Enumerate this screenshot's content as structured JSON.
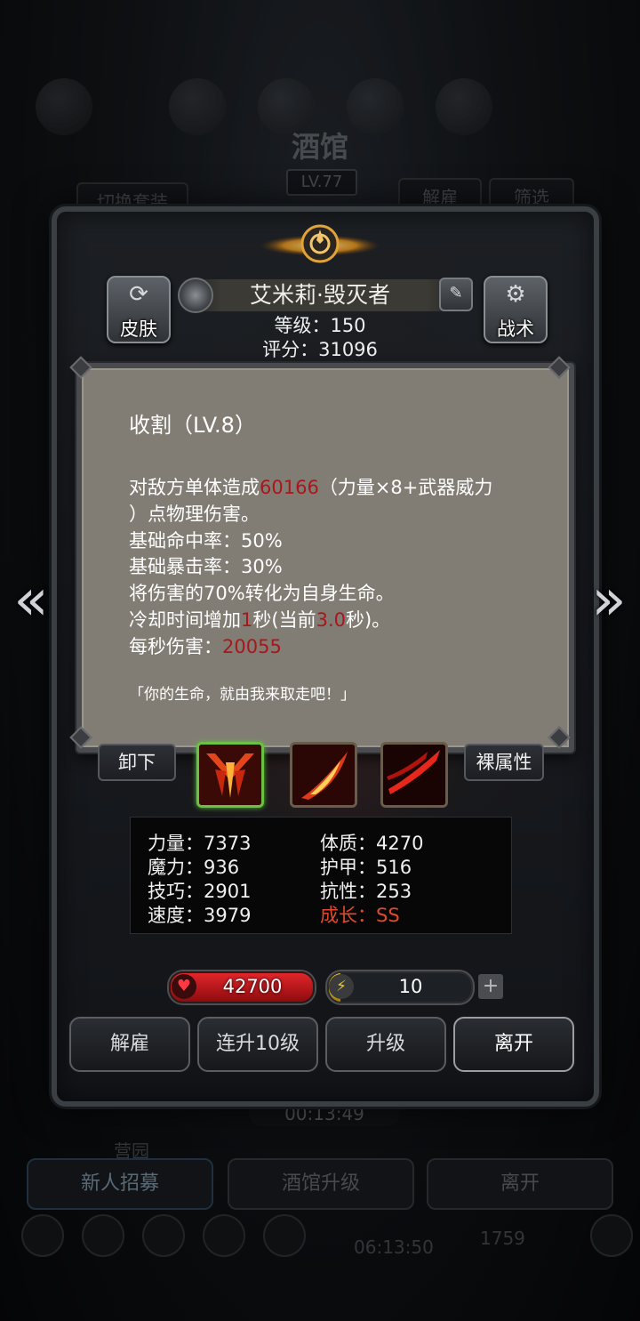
{
  "background": {
    "title": "酒馆",
    "level": "LV.77",
    "switch_outfit": "切换套装",
    "dismiss": "解雇",
    "filter": "筛选",
    "timer": "00:13:49",
    "tabs": [
      "新人招募",
      "酒馆升级",
      "离开"
    ],
    "label_small": "营园",
    "bottom_timer": "06:13:50",
    "bottom_count": "1759"
  },
  "hero": {
    "name": "艾米莉·毁灭者",
    "level_text": "等级：150",
    "score_text": "评分：31096",
    "skin_label": "皮肤",
    "tactics_label": "战术"
  },
  "tooltip": {
    "title": "收割（LV.8）",
    "line1_pre": "对敌方单体造成",
    "line1_val": "60166",
    "line1_post": "（力量×8+武器威力",
    "line2": "）点物理伤害。",
    "line3": "基础命中率：50%",
    "line4": "基础暴击率：30%",
    "line5": "将伤害的70%转化为自身生命。",
    "line6_pre": "冷却时间增加",
    "line6_val1": "1",
    "line6_mid": "秒(当前",
    "line6_val2": "3.0",
    "line6_post": "秒)。",
    "line7_pre": "每秒伤害：",
    "line7_val": "20055",
    "quote": "「你的生命，就由我来取走吧！」"
  },
  "skills": {
    "unequip": "卸下",
    "naked_attr": "裸属性"
  },
  "stats": {
    "str": "力量：7373",
    "con": "体质：4270",
    "mag": "魔力：936",
    "arm": "护甲：516",
    "skl": "技巧：2901",
    "res": "抗性：253",
    "spd": "速度：3979",
    "grow": "成长：SS"
  },
  "resources": {
    "hp": "42700",
    "energy": "10",
    "energy_fill_fraction": 0.08
  },
  "actions": {
    "dismiss": "解雇",
    "level10": "连升10级",
    "levelup": "升级",
    "leave": "离开"
  },
  "colors": {
    "accent_red": "#a8171b",
    "growth_orange": "#e2482a",
    "active_green": "#6ac144"
  }
}
